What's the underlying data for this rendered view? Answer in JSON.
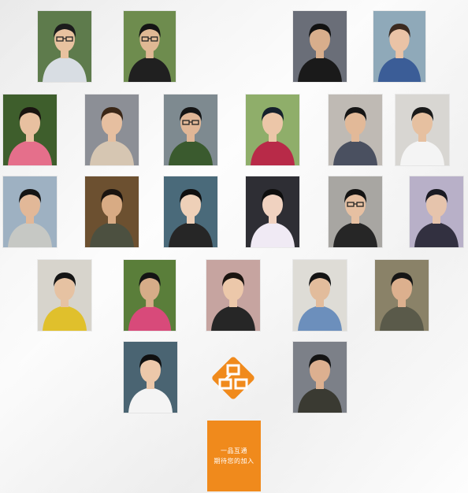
{
  "join_box": {
    "line1": "一品互通",
    "line2": "期待您的加入"
  },
  "brand": {
    "color": "#f08a1c",
    "logo_icon": "diamond-brand-logo"
  },
  "photos": [
    {
      "bg": "#5e7b4c",
      "shirt": "#d8dde3",
      "skin": "#e8c2a0",
      "hair": "#1c1c1c",
      "glasses": true
    },
    {
      "bg": "#6e8c4e",
      "shirt": "#202020",
      "skin": "#e0b894",
      "hair": "#141414",
      "glasses": true
    },
    {
      "bg": "#6a6e78",
      "shirt": "#1a1a1a",
      "skin": "#d8ae8c",
      "hair": "#111111",
      "glasses": false
    },
    {
      "bg": "#8fa9b9",
      "shirt": "#3b5d97",
      "skin": "#eac3a6",
      "hair": "#3b2a20",
      "glasses": false
    },
    {
      "bg": "#3e5e2c",
      "shirt": "#e56f8b",
      "skin": "#e8c0a0",
      "hair": "#1a1410",
      "glasses": false
    },
    {
      "bg": "#8c8f96",
      "shirt": "#d6c6b2",
      "skin": "#e6bfa0",
      "hair": "#3a2616",
      "glasses": false
    },
    {
      "bg": "#7e8a90",
      "shirt": "#3a5a2e",
      "skin": "#e0b696",
      "hair": "#151515",
      "glasses": true
    },
    {
      "bg": "#8fae6a",
      "shirt": "#b82a48",
      "skin": "#ecc6a8",
      "hair": "#16202c",
      "glasses": false
    },
    {
      "bg": "#bfbab4",
      "shirt": "#4a5060",
      "skin": "#e2b998",
      "hair": "#151515",
      "glasses": false
    },
    {
      "bg": "#d8d6d2",
      "shirt": "#f4f4f4",
      "skin": "#e6c0a0",
      "hair": "#1a1a1a",
      "glasses": false
    },
    {
      "bg": "#9eb1c2",
      "shirt": "#c6c8c4",
      "skin": "#e2b898",
      "hair": "#151515",
      "glasses": false
    },
    {
      "bg": "#6c5030",
      "shirt": "#4c5040",
      "skin": "#d8ab84",
      "hair": "#1a1410",
      "glasses": false
    },
    {
      "bg": "#4a6a7a",
      "shirt": "#262626",
      "skin": "#eed0b8",
      "hair": "#101010",
      "glasses": false
    },
    {
      "bg": "#2e2e34",
      "shirt": "#f0eaf4",
      "skin": "#f0d2c0",
      "hair": "#0e0e0e",
      "glasses": false
    },
    {
      "bg": "#a8a6a2",
      "shirt": "#262626",
      "skin": "#e6c0a2",
      "hair": "#141414",
      "glasses": true
    },
    {
      "bg": "#b8b0c8",
      "shirt": "#323040",
      "skin": "#e6c4ac",
      "hair": "#1a1a22",
      "glasses": false
    },
    {
      "bg": "#d7d4cc",
      "shirt": "#e0c02c",
      "skin": "#e6c2a2",
      "hair": "#151515",
      "glasses": false
    },
    {
      "bg": "#5a7e3a",
      "shirt": "#d84a7a",
      "skin": "#d6ac88",
      "hair": "#141414",
      "glasses": false
    },
    {
      "bg": "#c6a4a0",
      "shirt": "#262626",
      "skin": "#ecc8aa",
      "hair": "#1a1410",
      "glasses": false
    },
    {
      "bg": "#dedcd6",
      "shirt": "#6c8fbc",
      "skin": "#e2bc9c",
      "hair": "#141414",
      "glasses": false
    },
    {
      "bg": "#8a8268",
      "shirt": "#5a5a4a",
      "skin": "#dcb08e",
      "hair": "#151515",
      "glasses": false
    },
    {
      "bg": "#4a6472",
      "shirt": "#f4f4f4",
      "skin": "#ecc8aa",
      "hair": "#101010",
      "glasses": false
    },
    {
      "bg": "#7c8088",
      "shirt": "#3a3a32",
      "skin": "#dcb090",
      "hair": "#141414",
      "glasses": false
    }
  ]
}
